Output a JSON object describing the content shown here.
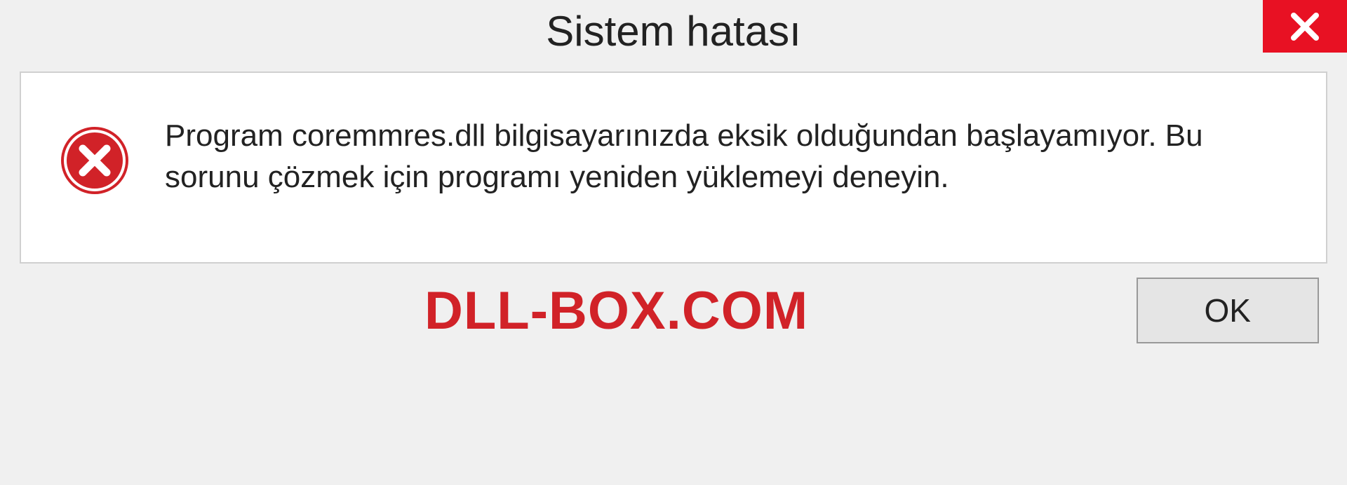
{
  "dialog": {
    "title": "Sistem hatası",
    "message": "Program coremmres.dll bilgisayarınızda eksik olduğundan başlayamıyor. Bu sorunu çözmek için programı yeniden yüklemeyi deneyin.",
    "ok_label": "OK"
  },
  "watermark": "DLL-BOX.COM"
}
